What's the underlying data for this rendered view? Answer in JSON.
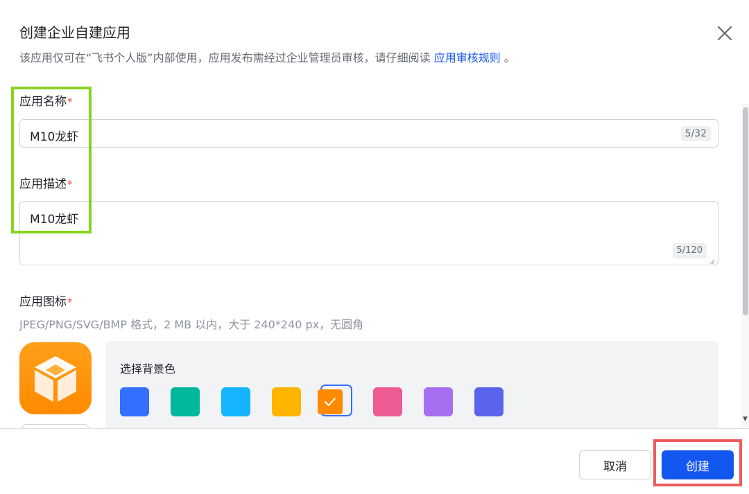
{
  "dialog": {
    "title": "创建企业自建应用",
    "subtitle_prefix": "该应用仅可在“飞书个人版”内部使用，应用发布需经过企业管理员审核，请仔细阅读",
    "subtitle_link": "应用审核规则",
    "subtitle_suffix": "。"
  },
  "form": {
    "name": {
      "label": "应用名称",
      "required": "*",
      "value": "M10龙虾",
      "counter": "5/32"
    },
    "description": {
      "label": "应用描述",
      "required": "*",
      "value": "M10龙虾",
      "counter": "5/120"
    },
    "icon": {
      "label": "应用图标",
      "required": "*",
      "hint": "JPEG/PNG/SVG/BMP 格式，2 MB 以内，大于 240*240 px，无圆角",
      "bg_label": "选择背景色",
      "colors": [
        "#3370ff",
        "#00b99b",
        "#14b4ff",
        "#ffb400",
        "#ff8a00",
        "#ec5b93",
        "#a66ff2",
        "#5b62eb"
      ],
      "selected_color": "#ff8a00"
    }
  },
  "footer": {
    "cancel_label": "取消",
    "create_label": "创建"
  },
  "icons": {
    "close": "close-icon",
    "check": "check-icon",
    "app": "cube-icon"
  }
}
